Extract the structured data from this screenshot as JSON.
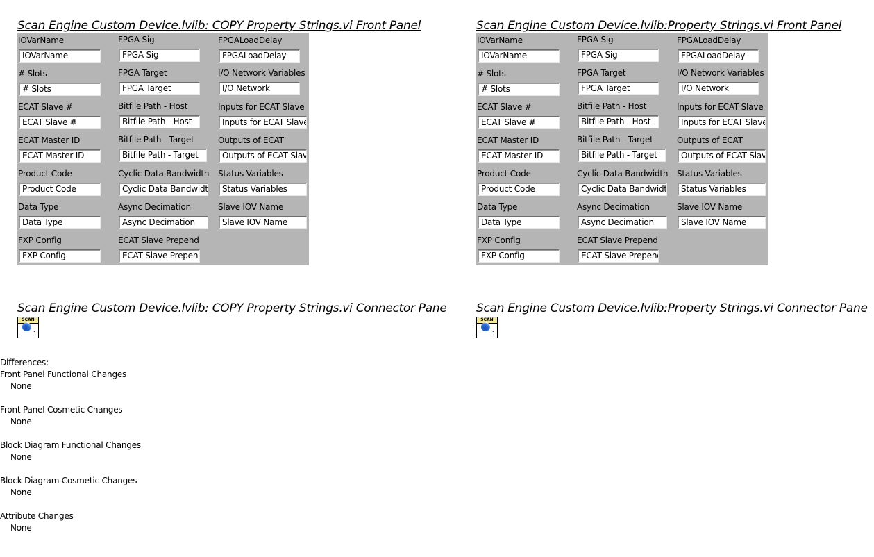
{
  "left": {
    "front_panel_title": "Scan Engine Custom Device.lvlib:  COPY  Property Strings.vi Front Panel",
    "connector_pane_title": "Scan Engine Custom Device.lvlib:  COPY  Property Strings.vi Connector Pane"
  },
  "right": {
    "front_panel_title": "Scan Engine Custom Device.lvlib:Property Strings.vi Front Panel",
    "connector_pane_title": "Scan Engine Custom Device.lvlib:Property Strings.vi Connector Pane"
  },
  "controls": [
    {
      "label": "IOVarName",
      "value": "IOVarName"
    },
    {
      "label": "# Slots",
      "value": "# Slots"
    },
    {
      "label": "ECAT Slave #",
      "value": "ECAT Slave #"
    },
    {
      "label": "ECAT Master ID",
      "value": "ECAT Master ID"
    },
    {
      "label": "Product Code",
      "value": "Product Code"
    },
    {
      "label": "Data Type",
      "value": "Data Type"
    },
    {
      "label": "FXP Config",
      "value": "FXP Config"
    },
    {
      "label": "FPGA Sig",
      "value": "FPGA Sig"
    },
    {
      "label": "FPGA Target",
      "value": "FPGA Target"
    },
    {
      "label": "Bitfile Path - Host",
      "value": "Bitfile Path - Host"
    },
    {
      "label": "Bitfile Path - Target",
      "value": "Bitfile Path - Target"
    },
    {
      "label": "Cyclic Data Bandwidth",
      "value": "Cyclic Data Bandwidth"
    },
    {
      "label": "Async Decimation",
      "value": "Async Decimation"
    },
    {
      "label": "ECAT Slave Prepend",
      "value": "ECAT Slave Prepend"
    },
    {
      "label": "FPGALoadDelay",
      "value": "FPGALoadDelay"
    },
    {
      "label": "I/O Network Variables",
      "value": "I/O Network"
    },
    {
      "label": "Inputs for ECAT Slave",
      "value": "Inputs for ECAT Slave"
    },
    {
      "label": "Outputs of ECAT",
      "value": "Outputs of ECAT Slave"
    },
    {
      "label": "Status Variables",
      "value": "Status Variables"
    },
    {
      "label": "Slave IOV Name",
      "value": "Slave IOV Name"
    }
  ],
  "connector_icon": {
    "icon_name": "scan-engine-vi-icon",
    "band_text": "SCAN",
    "terminal_number": "1"
  },
  "differences": {
    "heading": "Differences:",
    "sections": [
      {
        "title": "Front Panel Functional Changes",
        "value": "None"
      },
      {
        "title": "Front Panel Cosmetic Changes",
        "value": "None"
      },
      {
        "title": "Block Diagram Functional Changes",
        "value": "None"
      },
      {
        "title": "Block Diagram Cosmetic Changes",
        "value": "None"
      },
      {
        "title": "Attribute Changes",
        "value": "None"
      }
    ]
  }
}
